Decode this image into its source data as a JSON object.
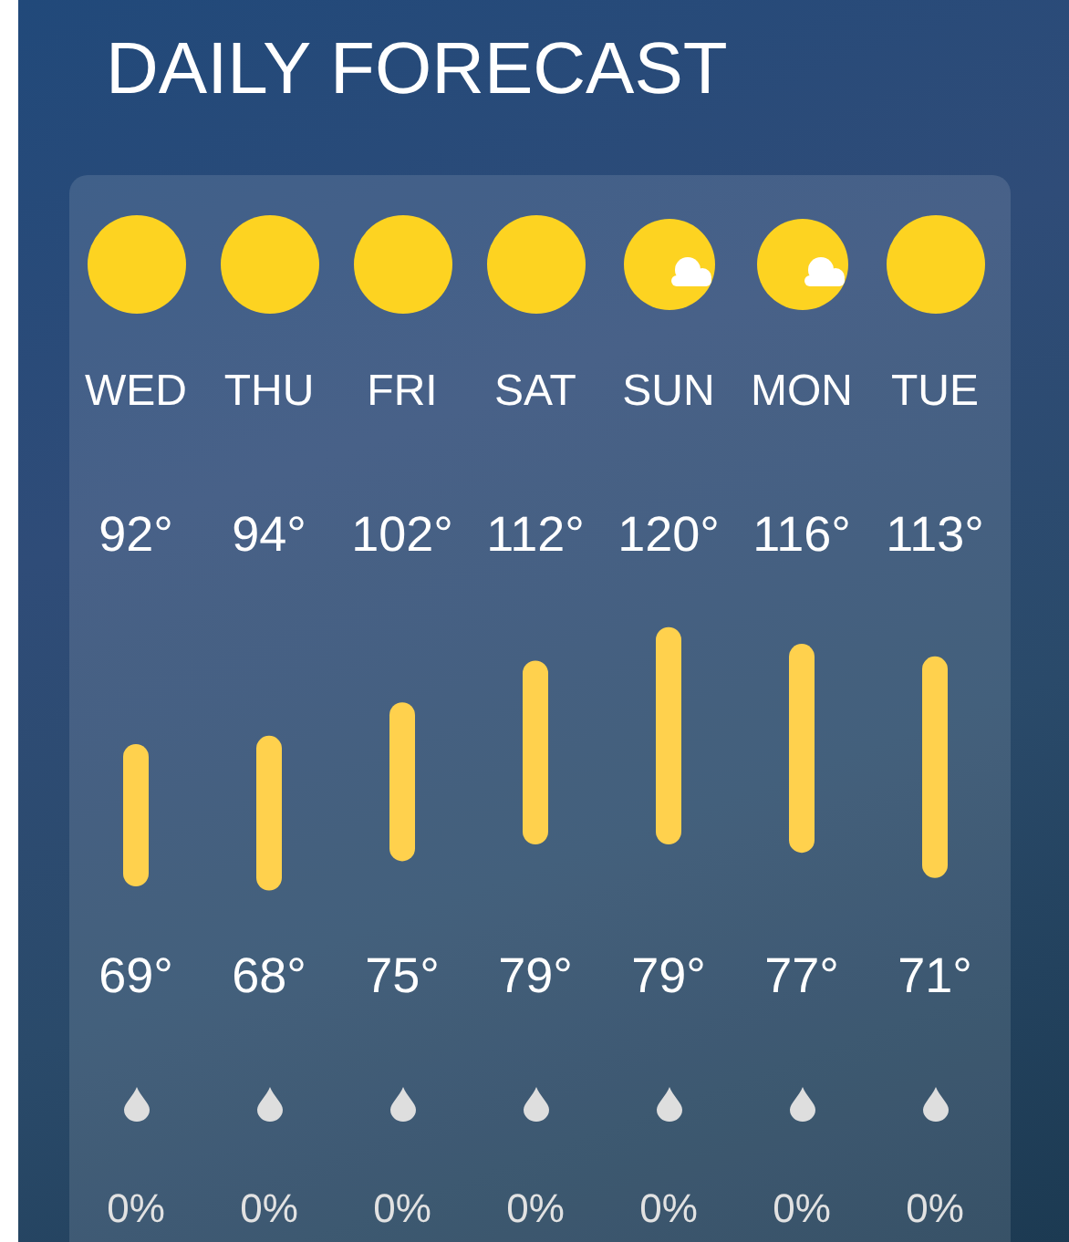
{
  "title": "DAILY FORECAST",
  "days": [
    {
      "day": "WED",
      "kind": "sunny",
      "high": "92°",
      "low": "69°",
      "precip": "0%"
    },
    {
      "day": "THU",
      "kind": "sunny",
      "high": "94°",
      "low": "68°",
      "precip": "0%"
    },
    {
      "day": "FRI",
      "kind": "sunny",
      "high": "102°",
      "low": "75°",
      "precip": "0%"
    },
    {
      "day": "SAT",
      "kind": "sunny",
      "high": "112°",
      "low": "79°",
      "precip": "0%"
    },
    {
      "day": "SUN",
      "kind": "partly_cloudy",
      "high": "120°",
      "low": "79°",
      "precip": "0%"
    },
    {
      "day": "MON",
      "kind": "partly_cloudy",
      "high": "116°",
      "low": "77°",
      "precip": "0%"
    },
    {
      "day": "TUE",
      "kind": "sunny",
      "high": "113°",
      "low": "71°",
      "precip": "0%"
    }
  ]
}
